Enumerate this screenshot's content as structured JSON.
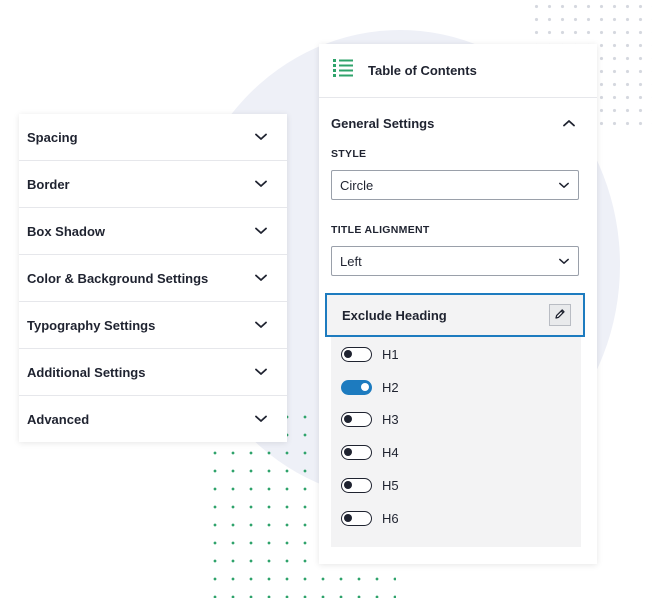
{
  "left_panel": {
    "items": [
      {
        "label": "Spacing"
      },
      {
        "label": "Border"
      },
      {
        "label": "Box Shadow"
      },
      {
        "label": "Color & Background Settings"
      },
      {
        "label": "Typography Settings"
      },
      {
        "label": "Additional Settings"
      },
      {
        "label": "Advanced"
      }
    ]
  },
  "right_panel": {
    "title": "Table of Contents",
    "section_title": "General Settings",
    "style_label": "STYLE",
    "style_value": "Circle",
    "alignment_label": "TITLE ALIGNMENT",
    "alignment_value": "Left",
    "exclude_heading_label": "Exclude Heading",
    "headings": [
      {
        "label": "H1",
        "enabled": false
      },
      {
        "label": "H2",
        "enabled": true
      },
      {
        "label": "H3",
        "enabled": false
      },
      {
        "label": "H4",
        "enabled": false
      },
      {
        "label": "H5",
        "enabled": false
      },
      {
        "label": "H6",
        "enabled": false
      }
    ]
  },
  "colors": {
    "accent": "#1d7bbf",
    "toc_icon": "#2fa36b",
    "dots": "#2fa36b"
  },
  "icons": {
    "toc": "list-icon",
    "chevron": "chevron-down-icon",
    "collapse": "chevron-up-icon",
    "edit": "pencil-icon"
  }
}
